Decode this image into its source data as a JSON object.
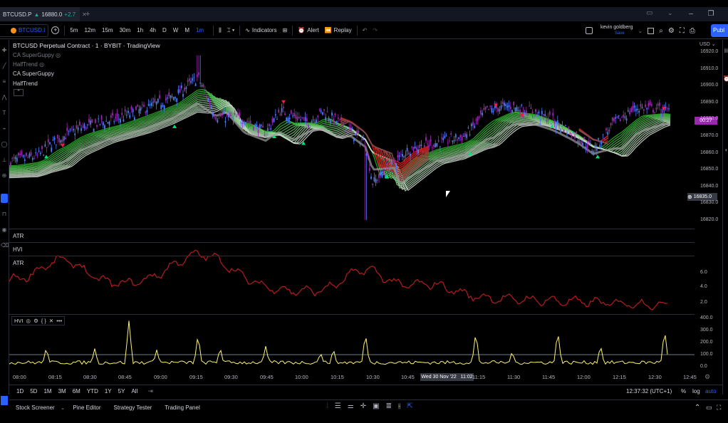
{
  "tabbar": {
    "tab_symbol": "BTCUSD.P",
    "tab_price": "16880.0",
    "tab_change": "+2.7",
    "new_tab": "+",
    "minimize": "–",
    "maximize": "❐",
    "close": "✕"
  },
  "toolbar": {
    "symbol": "BTCUSD.I",
    "add": "+",
    "intervals": [
      "5m",
      "12m",
      "15m",
      "30m",
      "1h",
      "4h",
      "D",
      "W",
      "M",
      "1m"
    ],
    "indicators": "Indicators",
    "alert": "Alert",
    "replay": "Replay",
    "user_name": "kevin goldberg",
    "user_sub": "Save",
    "publish": "Publ"
  },
  "chart": {
    "title": "BTCUSD Perpetual Contract · 1 · BYBIT · TradingView",
    "legend": [
      "CA SuperGuppy",
      "HalfTrend",
      "CA SuperGuppy",
      "HalfTrend"
    ],
    "currency": "USD",
    "price_ticks": [
      "16920.0",
      "16910.0",
      "16900.0",
      "16890.0",
      "16880.0",
      "16870.0",
      "16860.0",
      "16850.0",
      "16840.0",
      "16830.0",
      "16820.0"
    ],
    "countdown": "00:27",
    "cursor_price": "16835.0",
    "colors": {
      "up": "#4d7cf0",
      "down": "#9c27b0",
      "green": "#00c853",
      "red": "#d50000"
    }
  },
  "panes": {
    "atr_collapsed": "ATR",
    "hvi_collapsed": "HVI",
    "atr_label": "ATR",
    "atr_ticks": [
      "6.0",
      "4.0",
      "2.0"
    ],
    "hvi_label": "HVI",
    "hvi_ticks": [
      "400.0",
      "300.0",
      "200.0",
      "100.0",
      "0.0"
    ]
  },
  "time_axis": {
    "labels": [
      "08:00",
      "08:15",
      "08:30",
      "08:45",
      "09:00",
      "09:15",
      "09:30",
      "09:45",
      "10:00",
      "10:15",
      "10:30",
      "10:45",
      "11:15",
      "11:30",
      "11:45",
      "12:00",
      "12:15",
      "12:30",
      "12:45"
    ],
    "cursor_time": "Wed 30 Nov '22   11:02"
  },
  "range_bar": {
    "ranges": [
      "1D",
      "5D",
      "1M",
      "3M",
      "6M",
      "YTD",
      "1Y",
      "5Y",
      "All"
    ],
    "clock": "12:37:32 (UTC+1)",
    "percent": "%",
    "log": "log",
    "auto": "auto"
  },
  "bottom_panel": {
    "tabs": [
      "Stock Screener",
      "Pine Editor",
      "Strategy Tester",
      "Trading Panel"
    ]
  }
}
